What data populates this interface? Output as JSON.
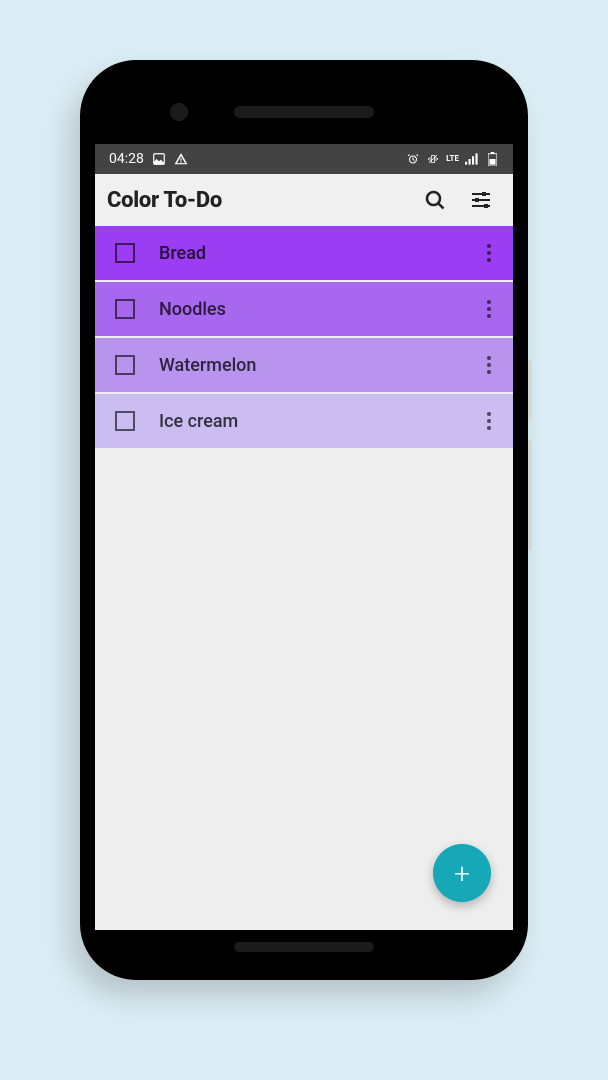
{
  "statusbar": {
    "time": "04:28",
    "network_label": "LTE"
  },
  "appbar": {
    "title": "Color To-Do"
  },
  "colors": {
    "fab": "#17a8b8"
  },
  "todos": [
    {
      "label": "Bread",
      "checked": false,
      "bg": "#9b3df2"
    },
    {
      "label": "Noodles",
      "checked": false,
      "bg": "#a867ef"
    },
    {
      "label": "Watermelon",
      "checked": false,
      "bg": "#b994ef"
    },
    {
      "label": "Ice cream",
      "checked": false,
      "bg": "#cbbdf2"
    }
  ],
  "fab": {
    "label": "+"
  }
}
